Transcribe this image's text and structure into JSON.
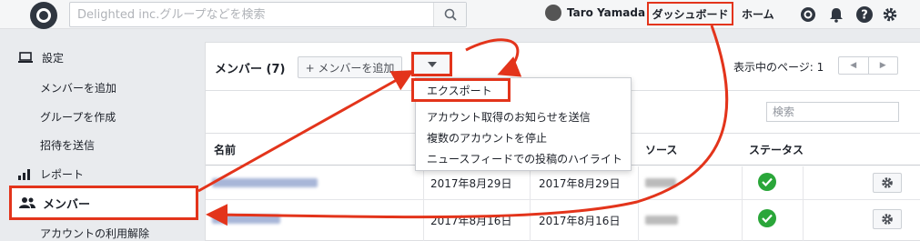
{
  "topbar": {
    "search_placeholder": "Delighted inc.グループなどを検索",
    "user_name": "Taro Yamada",
    "nav_dashboard": "ダッシュボード",
    "nav_home": "ホーム"
  },
  "sidebar": {
    "settings": "設定",
    "add_member": "メンバーを追加",
    "create_group": "グループを作成",
    "send_invite": "招待を送信",
    "reports": "レポート",
    "members": "メンバー",
    "deactivate": "アカウントの利用解除"
  },
  "main": {
    "title": "メンバー (7)",
    "add_member_button": "+ メンバーを追加",
    "page_info": "表示中のページ: 1",
    "search_placeholder": "検索",
    "columns": {
      "name": "名前",
      "source": "ソース",
      "status": "ステータス"
    },
    "rows": [
      {
        "date1": "2017年8月29日",
        "date2": "2017年8月29日"
      },
      {
        "date1": "2017年8月16日",
        "date2": "2017年8月16日"
      }
    ]
  },
  "menu": {
    "items": [
      "エクスポート",
      "アカウント取得のお知らせを送信",
      "複数のアカウントを停止",
      "ニュースフィードでの投稿のハイライト"
    ]
  },
  "colors": {
    "highlight": "#e3341b",
    "status_active": "#2aa639"
  }
}
